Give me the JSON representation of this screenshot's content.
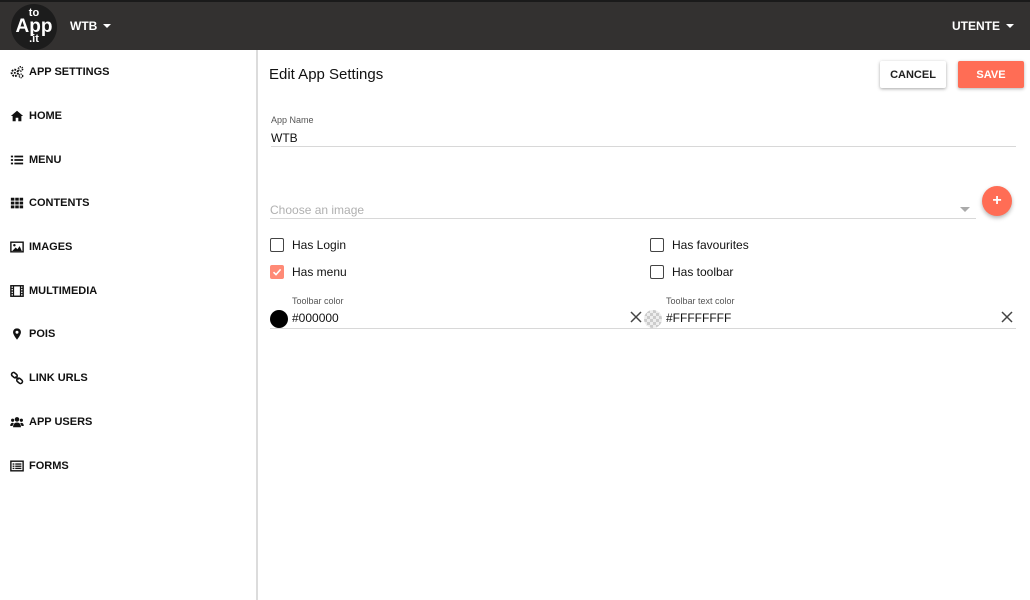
{
  "topbar": {
    "logo_text": [
      "to",
      "App",
      ".it"
    ],
    "app_name": "WTB",
    "user_label": "UTENTE"
  },
  "sidebar": {
    "items": [
      {
        "label": "APP SETTINGS",
        "icon": "gears-icon"
      },
      {
        "label": "HOME",
        "icon": "home-icon"
      },
      {
        "label": "MENU",
        "icon": "list-icon"
      },
      {
        "label": "CONTENTS",
        "icon": "grid-icon"
      },
      {
        "label": "IMAGES",
        "icon": "image-icon"
      },
      {
        "label": "MULTIMEDIA",
        "icon": "film-icon"
      },
      {
        "label": "POIS",
        "icon": "map-marker-icon"
      },
      {
        "label": "LINK URLS",
        "icon": "link-icon"
      },
      {
        "label": "APP USERS",
        "icon": "users-icon"
      },
      {
        "label": "FORMS",
        "icon": "form-icon"
      }
    ]
  },
  "main": {
    "title": "Edit App Settings",
    "cancel_label": "CANCEL",
    "save_label": "SAVE",
    "app_name_label": "App Name",
    "app_name_value": "WTB",
    "image_select_placeholder": "Choose an image",
    "add_button_label": "+",
    "checkboxes": [
      {
        "label": "Has Login",
        "checked": false
      },
      {
        "label": "Has menu",
        "checked": true
      },
      {
        "label": "Has favourites",
        "checked": false
      },
      {
        "label": "Has toolbar",
        "checked": false
      }
    ],
    "toolbar_color_label": "Toolbar color",
    "toolbar_color_value": "#000000",
    "toolbar_text_color_label": "Toolbar text color",
    "toolbar_text_color_value": "#FFFFFFFF"
  },
  "colors": {
    "accent": "#ff6d55",
    "topbar": "#333130"
  }
}
